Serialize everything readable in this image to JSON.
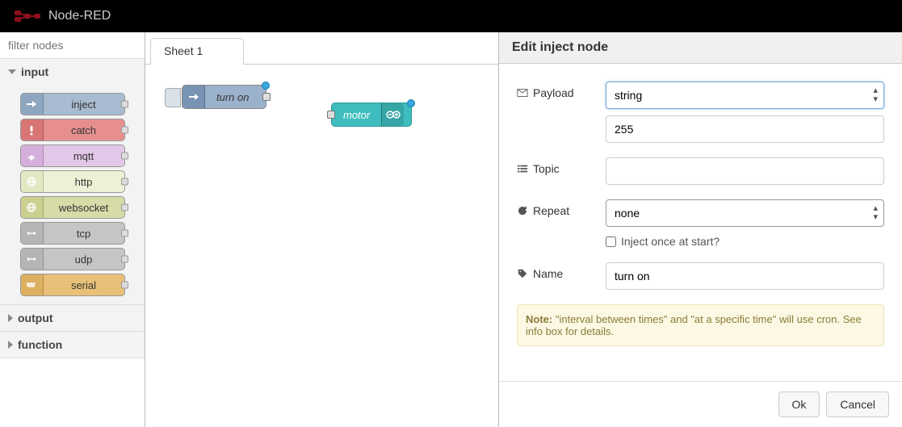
{
  "app_title": "Node-RED",
  "filter_placeholder": "filter nodes",
  "categories": [
    {
      "key": "input",
      "label": "input",
      "expanded": true
    },
    {
      "key": "output",
      "label": "output",
      "expanded": false
    },
    {
      "key": "function",
      "label": "function",
      "expanded": false
    }
  ],
  "input_nodes": {
    "inject": "inject",
    "catch": "catch",
    "mqtt": "mqtt",
    "http": "http",
    "websocket": "websocket",
    "tcp": "tcp",
    "udp": "udp",
    "serial": "serial"
  },
  "workspace": {
    "tab_label": "Sheet 1",
    "nodes": {
      "turnon_label": "turn on",
      "motor_label": "motor"
    }
  },
  "edit": {
    "title": "Edit inject node",
    "labels": {
      "payload": "Payload",
      "topic": "Topic",
      "repeat": "Repeat",
      "name": "Name"
    },
    "payload_type": "string",
    "payload_value": "255",
    "topic_value": "",
    "repeat_value": "none",
    "inject_once_label": "Inject once at start?",
    "inject_once_checked": false,
    "name_value": "turn on",
    "note_bold": "Note:",
    "note_text": " \"interval between times\" and \"at a specific time\" will use cron. See info box for details.",
    "ok_label": "Ok",
    "cancel_label": "Cancel"
  }
}
